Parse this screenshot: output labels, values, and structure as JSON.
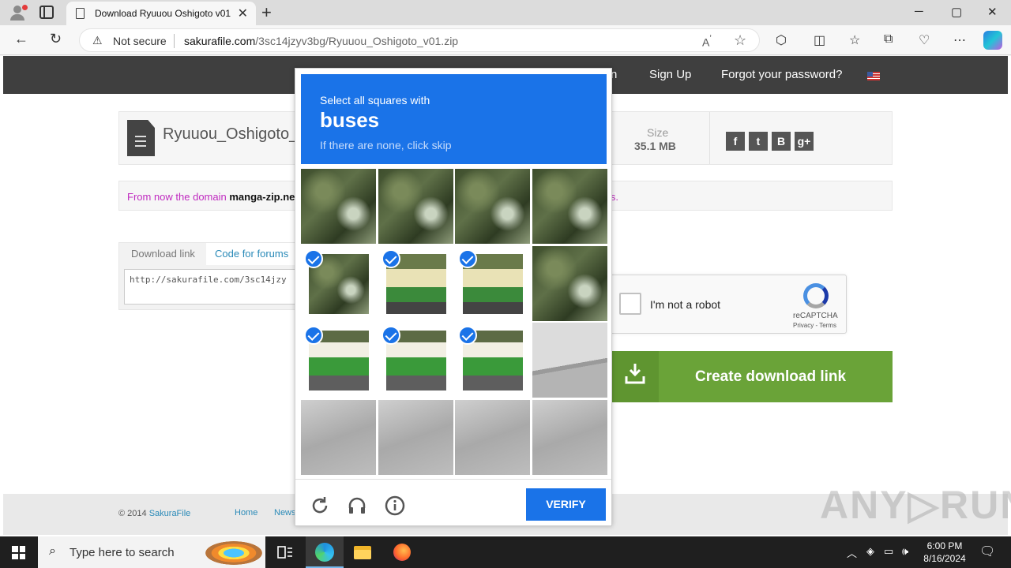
{
  "browser": {
    "tab_title": "Download Ryuuou Oshigoto v01",
    "security_label": "Not secure",
    "url_host": "sakurafile.com",
    "url_path": "/3sc14jzyv3bg/Ryuuou_Oshigoto_v01.zip",
    "window_controls": [
      "─",
      "▢",
      "✕"
    ]
  },
  "site": {
    "nav": {
      "partial_item": "n",
      "signup": "Sign Up",
      "forgot": "Forgot your password?"
    },
    "file": {
      "name": "Ryuuou_Oshigoto_v",
      "size_label": "Size",
      "size_value": "35.1 MB",
      "social": [
        "f",
        "t",
        "B",
        "g+"
      ]
    },
    "notice": {
      "prefix": "From now the domain ",
      "domain": "manga-zip.net",
      "suffix": "rks."
    },
    "download": {
      "tab_link": "Download link",
      "tab_forums": "Code for forums",
      "code": "http://sakurafile.com/3sc14jzy"
    },
    "recaptcha": {
      "label": "I'm not a robot",
      "brand": "reCAPTCHA",
      "links": "Privacy - Terms"
    },
    "create_button": "Create download link",
    "footer": {
      "copyright": "© 2014 ",
      "brand": "SakuraFile",
      "home": "Home",
      "news": "News"
    }
  },
  "captcha": {
    "line1": "Select all squares with",
    "target": "buses",
    "line3": "If there are none, click skip",
    "verify": "VERIFY",
    "tiles": [
      {
        "kind": "veg",
        "selected": false
      },
      {
        "kind": "veg",
        "selected": false
      },
      {
        "kind": "veg",
        "selected": false
      },
      {
        "kind": "veg",
        "selected": false
      },
      {
        "kind": "veg",
        "selected": true
      },
      {
        "kind": "bus",
        "selected": true
      },
      {
        "kind": "bus",
        "selected": true
      },
      {
        "kind": "veg",
        "selected": false
      },
      {
        "kind": "busw",
        "selected": true
      },
      {
        "kind": "busw",
        "selected": true
      },
      {
        "kind": "busw",
        "selected": true
      },
      {
        "kind": "curb",
        "selected": false
      },
      {
        "kind": "road",
        "selected": false
      },
      {
        "kind": "road",
        "selected": false
      },
      {
        "kind": "road",
        "selected": false
      },
      {
        "kind": "road",
        "selected": false
      }
    ]
  },
  "watermark": "ANY▷RUN",
  "taskbar": {
    "search_placeholder": "Type here to search",
    "time": "6:00 PM",
    "date": "8/16/2024"
  }
}
